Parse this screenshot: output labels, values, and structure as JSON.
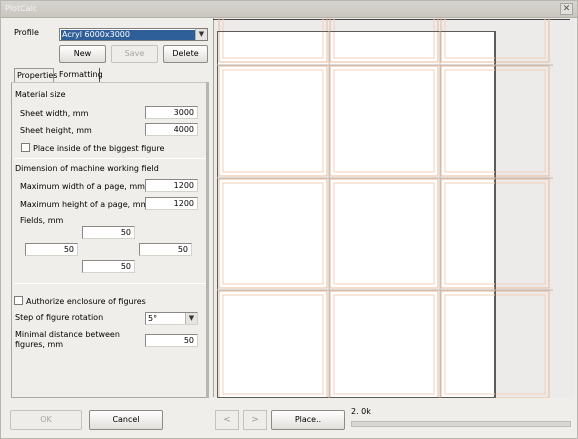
{
  "window": {
    "title": "PlotCalc",
    "close_symbol": "✕"
  },
  "profile": {
    "label": "Profile",
    "value": "Acryl 6000x3000"
  },
  "buttons": {
    "new": "New",
    "save": "Save",
    "delete": "Delete",
    "ok": "OK",
    "cancel": "Cancel",
    "place": "Place..",
    "prev": "<",
    "next": ">"
  },
  "tabs": [
    "Properties",
    "Formatting"
  ],
  "material": {
    "title": "Material size",
    "sheet_width_label": "Sheet width, mm",
    "sheet_width": "3000",
    "sheet_height_label": "Sheet height, mm",
    "sheet_height": "4000",
    "place_inside_label": "Place inside of the biggest figure"
  },
  "machine": {
    "title": "Dimension of machine working field",
    "max_width_label": "Maximum width of a page, mm",
    "max_width": "1200",
    "max_height_label": "Maximum height of a page, mm",
    "max_height": "1200",
    "fields_label": "Fields, mm",
    "field_top": "50",
    "field_left": "50",
    "field_right": "50",
    "field_bottom": "50"
  },
  "options": {
    "authorize_label": "Authorize enclosure of figures",
    "rotation_label": "Step of figure rotation",
    "rotation_value": "5°",
    "min_distance_label": "Minimal distance between figures, mm",
    "min_distance": "50"
  },
  "status": {
    "text": "2. 0k",
    "progress": 0.0
  },
  "colors": {
    "selection": "#2f5f99",
    "grid_line": "#e8b89b",
    "page_border": "#f0cfba"
  }
}
